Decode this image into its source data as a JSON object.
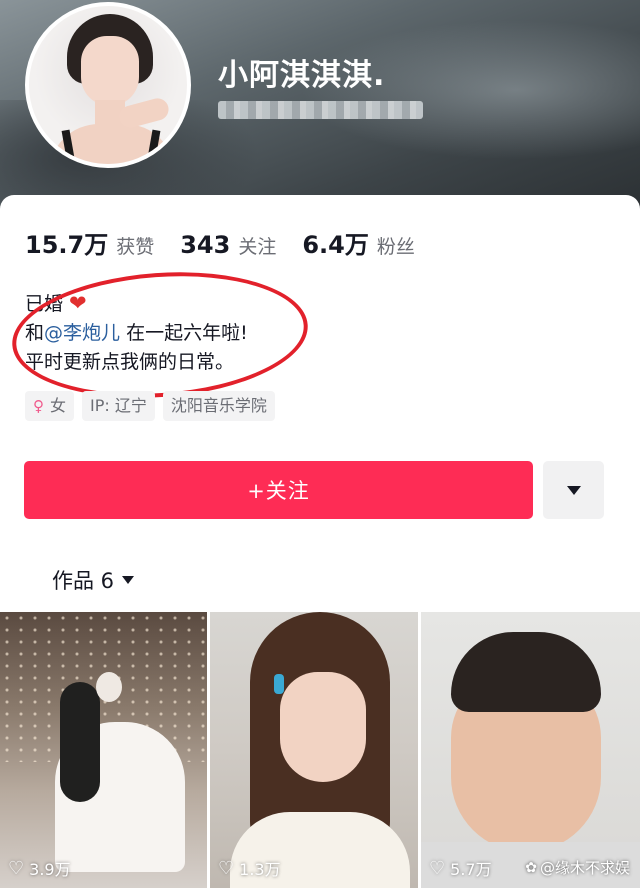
{
  "profile": {
    "nickname": "小阿淇淇淇.",
    "stats": [
      {
        "value": "15.7万",
        "label": "获赞"
      },
      {
        "value": "343",
        "label": "关注"
      },
      {
        "value": "6.4万",
        "label": "粉丝"
      }
    ],
    "bio": {
      "line1": "已婚",
      "line2_prefix": "和",
      "mention": "@李炮儿",
      "line2_suffix": " 在一起六年啦!",
      "line3": "平时更新点我俩的日常。"
    },
    "tags": [
      {
        "icon": "female-icon",
        "text": "女"
      },
      {
        "text": "IP: 辽宁"
      },
      {
        "text": "沈阳音乐学院"
      }
    ]
  },
  "actions": {
    "follow_label": "+关注",
    "more_icon": "triangle-down-icon"
  },
  "works_tab": {
    "label": "作品 6"
  },
  "videos": [
    {
      "likes": "3.9万"
    },
    {
      "likes": "1.3万"
    },
    {
      "likes": "5.7万"
    }
  ],
  "watermark": {
    "text": "@缘木不求娱"
  },
  "colors": {
    "accent": "#fe2c55",
    "annotation": "#e2212b",
    "mention": "#2b5f9e"
  }
}
